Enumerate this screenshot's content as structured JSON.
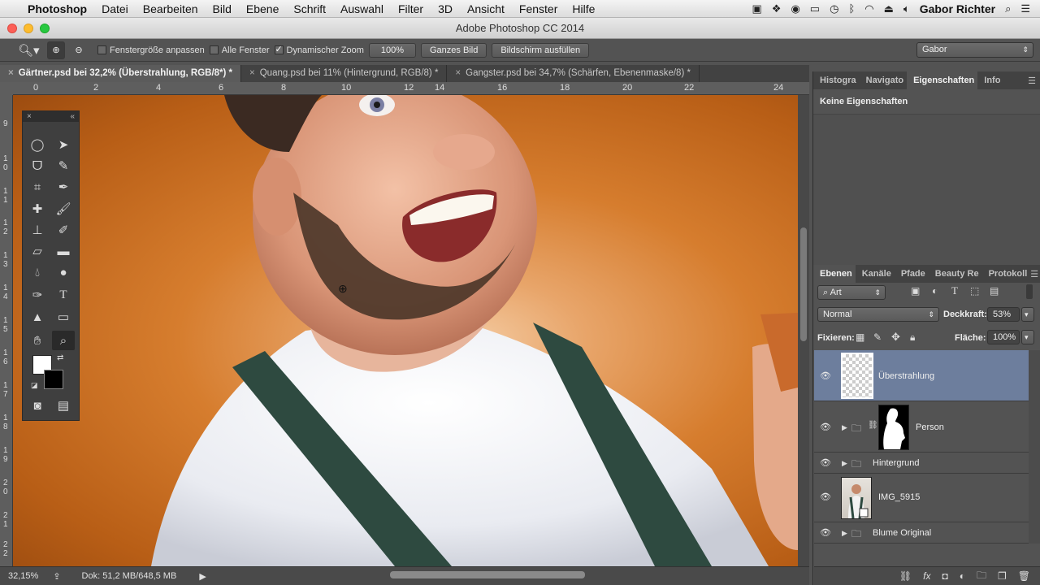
{
  "menubar": {
    "app": "Photoshop",
    "items": [
      "Datei",
      "Bearbeiten",
      "Bild",
      "Ebene",
      "Schrift",
      "Auswahl",
      "Filter",
      "3D",
      "Ansicht",
      "Fenster",
      "Hilfe"
    ],
    "user": "Gabor Richter"
  },
  "window": {
    "title": "Adobe Photoshop CC 2014"
  },
  "options": {
    "resize_windows": "Fenstergröße anpassen",
    "all_windows": "Alle Fenster",
    "scrubby_zoom": "Dynamischer Zoom",
    "zoom_100": "100%",
    "fit_screen": "Ganzes Bild",
    "fill_screen": "Bildschirm ausfüllen",
    "workspace": "Gabor"
  },
  "tabs": [
    {
      "label": "Gärtner.psd bei 32,2% (Überstrahlung, RGB/8*) *"
    },
    {
      "label": "Quang.psd bei 11% (Hintergrund, RGB/8) *"
    },
    {
      "label": "Gangster.psd bei 34,7% (Schärfen, Ebenenmaske/8) *"
    }
  ],
  "ruler_h": [
    "0",
    "2",
    "4",
    "6",
    "8",
    "10",
    "12",
    "14",
    "16",
    "18",
    "20",
    "22",
    "24"
  ],
  "ruler_v": [
    "9",
    "1 0",
    "1 1",
    "1 2",
    "1 3",
    "1 4",
    "1 5",
    "1 6",
    "1 7",
    "1 8",
    "1 9",
    "2 0",
    "2 1",
    "2 2",
    "2 3"
  ],
  "status": {
    "zoom": "32,15%",
    "doc": "Dok: 51,2 MB/648,5 MB"
  },
  "panels": {
    "top_tabs": [
      "Histogra",
      "Navigato",
      "Eigenschaften",
      "Info"
    ],
    "properties_text": "Keine Eigenschaften",
    "layer_tabs": [
      "Ebenen",
      "Kanäle",
      "Pfade",
      "Beauty Re",
      "Protokoll"
    ],
    "filter_kind": "Art",
    "blend_mode": "Normal",
    "opacity_label": "Deckkraft:",
    "opacity_value": "53%",
    "lock_label": "Fixieren:",
    "fill_label": "Fläche:",
    "fill_value": "100%"
  },
  "layers": [
    {
      "name": "Überstrahlung"
    },
    {
      "name": "Person"
    },
    {
      "name": "Hintergrund"
    },
    {
      "name": "IMG_5915"
    },
    {
      "name": "Blume Original"
    }
  ],
  "colors": {
    "accent_selected_layer": "#6d7e9d",
    "canvas_bg": "#d67d2e"
  }
}
